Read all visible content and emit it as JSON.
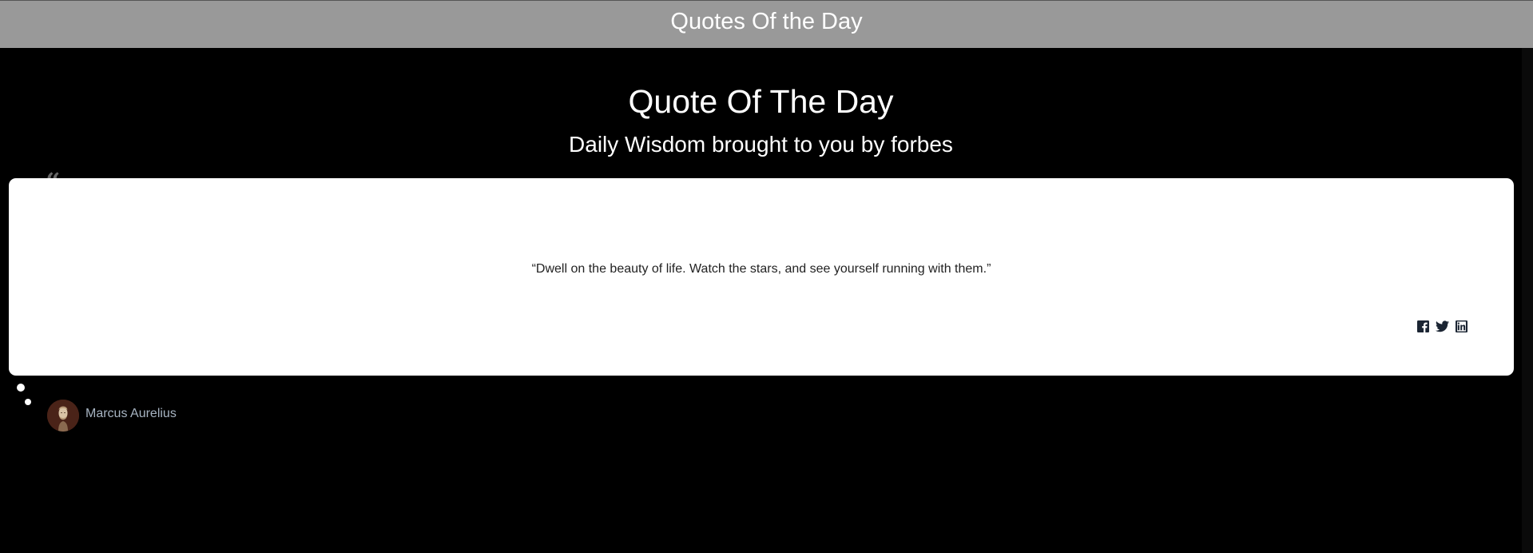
{
  "header": {
    "title": "Quotes Of the Day"
  },
  "main": {
    "heading": "Quote Of The Day",
    "subheading": "Daily Wisdom brought to you by forbes"
  },
  "quote": {
    "text": "“Dwell on the beauty of life. Watch the stars, and see yourself running with them.”",
    "author": "Marcus Aurelius",
    "share_icons": [
      "facebook-icon",
      "twitter-icon",
      "linkedin-icon"
    ]
  },
  "colors": {
    "header_bg": "#999999",
    "page_bg": "#000000",
    "card_bg": "#ffffff",
    "author_text": "#a7b4c2"
  }
}
